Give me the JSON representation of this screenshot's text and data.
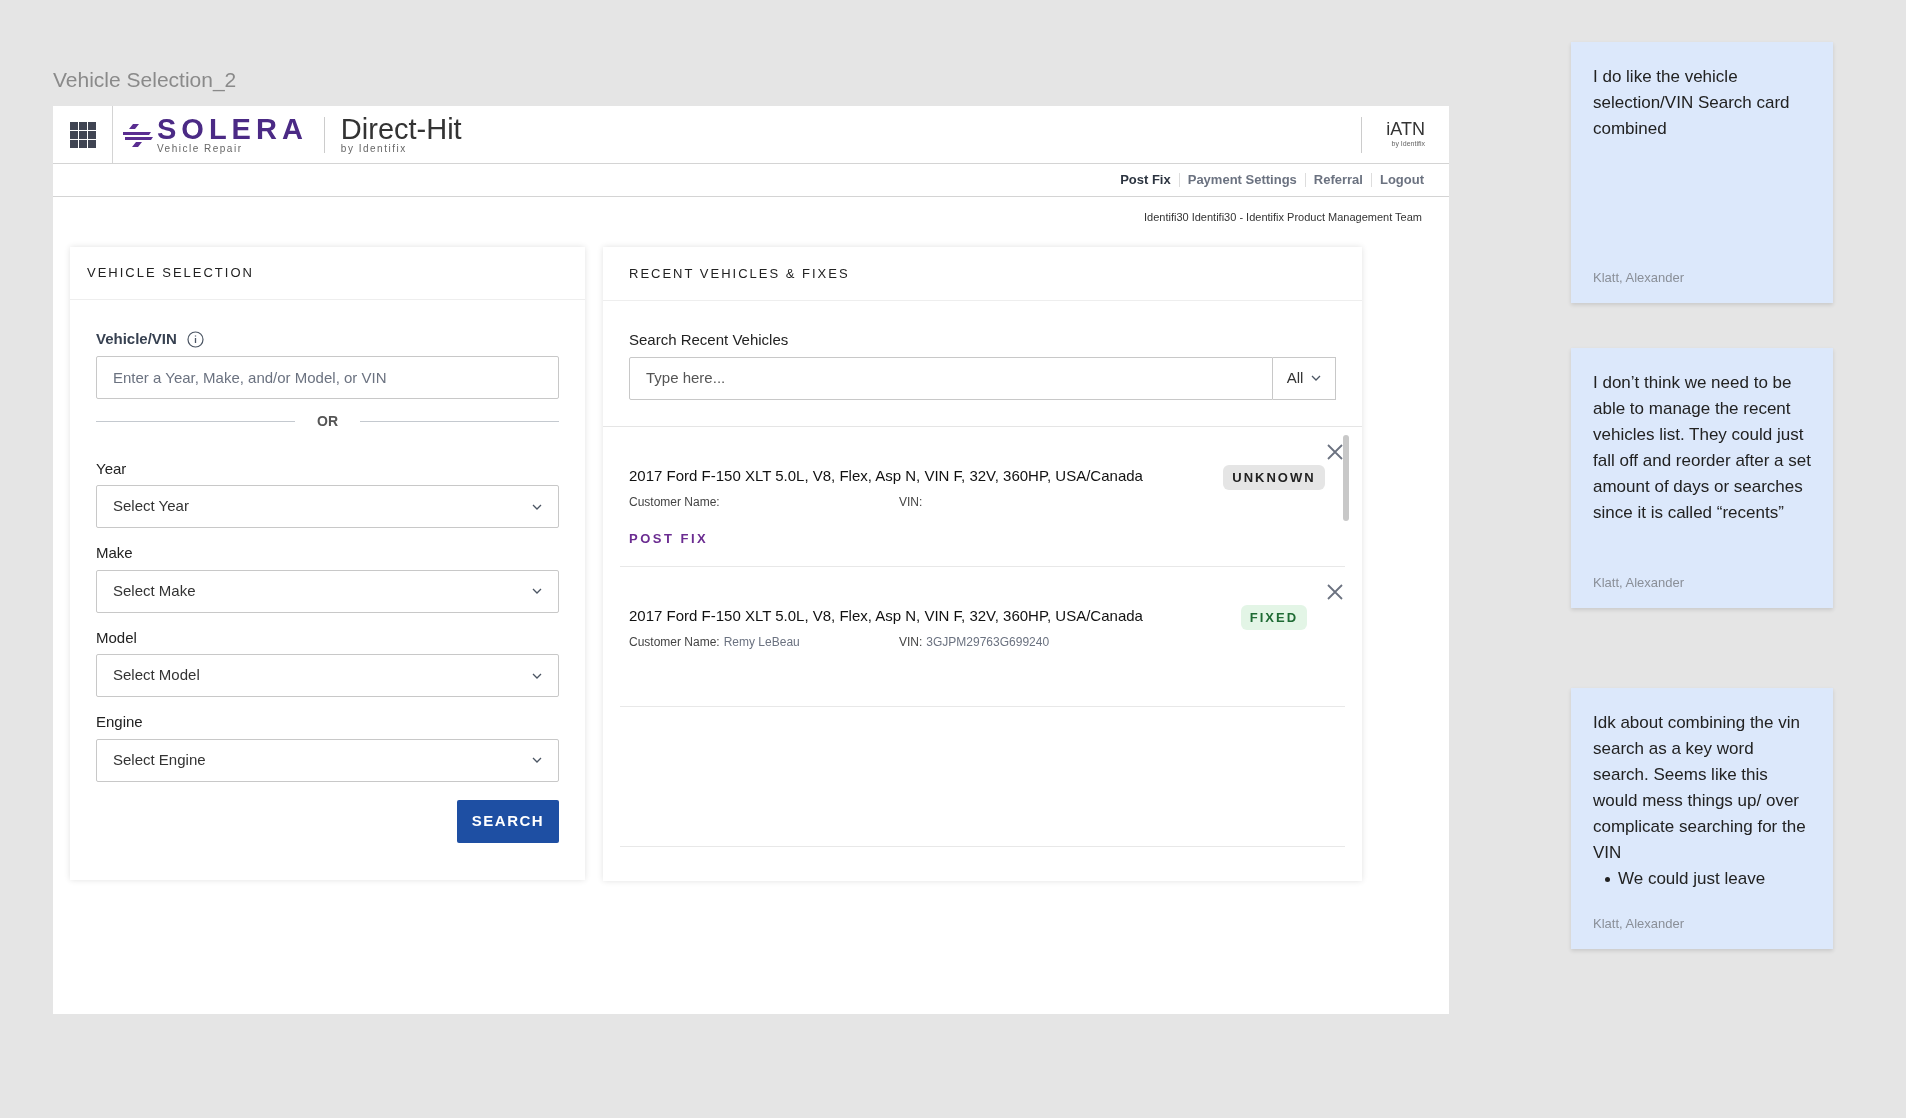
{
  "frame_title": "Vehicle Selection_2",
  "header": {
    "brand": "SOLERA",
    "brand_sub": "Vehicle Repair",
    "product": "Direct-Hit",
    "product_sub": "by Identifix",
    "partner": "iATN",
    "partner_sub": "by Identifix"
  },
  "nav": [
    {
      "label": "Post Fix",
      "selected": true
    },
    {
      "label": "Payment Settings",
      "selected": false
    },
    {
      "label": "Referral",
      "selected": false
    },
    {
      "label": "Logout",
      "selected": false
    }
  ],
  "user_line": "Identifi30 Identifi30 - Identifix Product Management Team",
  "vehicle_selection": {
    "title": "VEHICLE SELECTION",
    "vin_label": "Vehicle/VIN",
    "vin_placeholder": "Enter a Year, Make, and/or Model, or VIN",
    "divider": "OR",
    "selects": [
      {
        "label": "Year",
        "placeholder": "Select Year"
      },
      {
        "label": "Make",
        "placeholder": "Select Make"
      },
      {
        "label": "Model",
        "placeholder": "Select Model"
      },
      {
        "label": "Engine",
        "placeholder": "Select Engine"
      }
    ],
    "search_button": "SEARCH"
  },
  "recent": {
    "title": "RECENT VEHICLES & FIXES",
    "search_label": "Search Recent Vehicles",
    "search_placeholder": "Type here...",
    "filter": "All",
    "items": [
      {
        "vehicle": "2017 Ford F-150 XLT 5.0L, V8, Flex, Asp N, VIN F, 32V, 360HP, USA/Canada",
        "customer_label": "Customer Name:",
        "vin_label": "VIN:",
        "status": {
          "text": "UNKNOWN",
          "kind": "unknown"
        },
        "action": "POST FIX"
      },
      {
        "vehicle": "2017 Ford F-150 XLT 5.0L, V8, Flex, Asp N, VIN F, 32V, 360HP, USA/Canada",
        "customer_label": "Customer Name:",
        "customer": "Remy LeBeau",
        "vin_label": "VIN:",
        "vin": "3GJPM29763G699240",
        "status": {
          "text": "FIXED",
          "kind": "fixed"
        }
      }
    ]
  },
  "notes": [
    {
      "text": "I do like the vehicle selection/VIN Search card combined",
      "author": "Klatt, Alexander"
    },
    {
      "text": "I don’t think we need to be able to manage the recent vehicles list. They could just fall off and reorder after a set amount of days or searches since it is called “recents”",
      "author": "Klatt, Alexander"
    },
    {
      "text": "Idk about combining the vin search as a key word search. Seems like this would mess things up/ over complicate searching for the VIN",
      "bullets": [
        "We could just leave"
      ],
      "author": "Klatt, Alexander"
    }
  ]
}
